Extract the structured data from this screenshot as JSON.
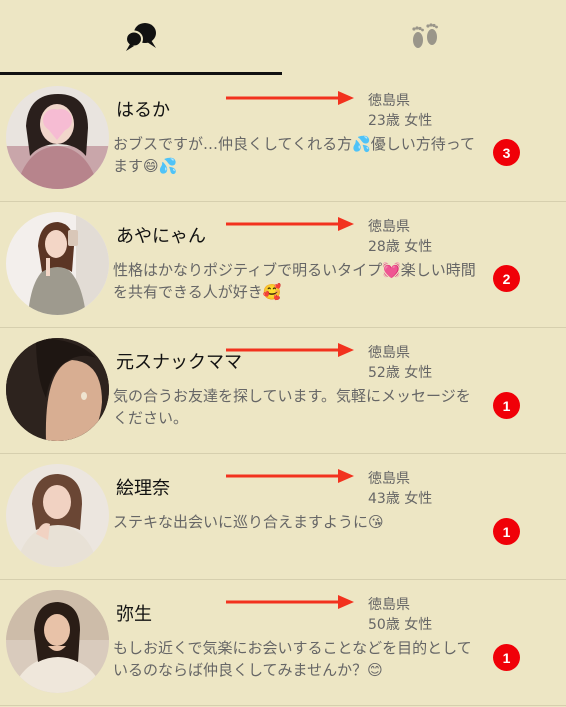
{
  "tabs": [
    {
      "icon": "chat-bubbles-icon",
      "active": true
    },
    {
      "icon": "footprints-icon",
      "active": false
    }
  ],
  "colors": {
    "background": "#ede6c4",
    "badge": "#f00008",
    "arrow": "#f2321e",
    "divider": "#d6cfae"
  },
  "conversations": [
    {
      "name": "はるか",
      "prefecture": "徳島県",
      "age_gender": "23歳 女性",
      "message": "おブスですが…仲良くしてくれる方💦優しい方待ってます😄💦",
      "unread": "3"
    },
    {
      "name": "あやにゃん",
      "prefecture": "徳島県",
      "age_gender": "28歳 女性",
      "message": "性格はかなりポジティブで明るいタイプ💓楽しい時間を共有できる人が好き🥰",
      "unread": "2"
    },
    {
      "name": "元スナックママ",
      "prefecture": "徳島県",
      "age_gender": "52歳 女性",
      "message": "気の合うお友達を探しています。気軽にメッセージをください。",
      "unread": "1"
    },
    {
      "name": "絵理奈",
      "prefecture": "徳島県",
      "age_gender": "43歳 女性",
      "message": "ステキな出会いに巡り合えますように😘",
      "unread": "1"
    },
    {
      "name": "弥生",
      "prefecture": "徳島県",
      "age_gender": "50歳 女性",
      "message": "もしお近くで気楽にお会いすることなどを目的としているのならば仲良くしてみませんか？😊",
      "unread": "1"
    }
  ]
}
